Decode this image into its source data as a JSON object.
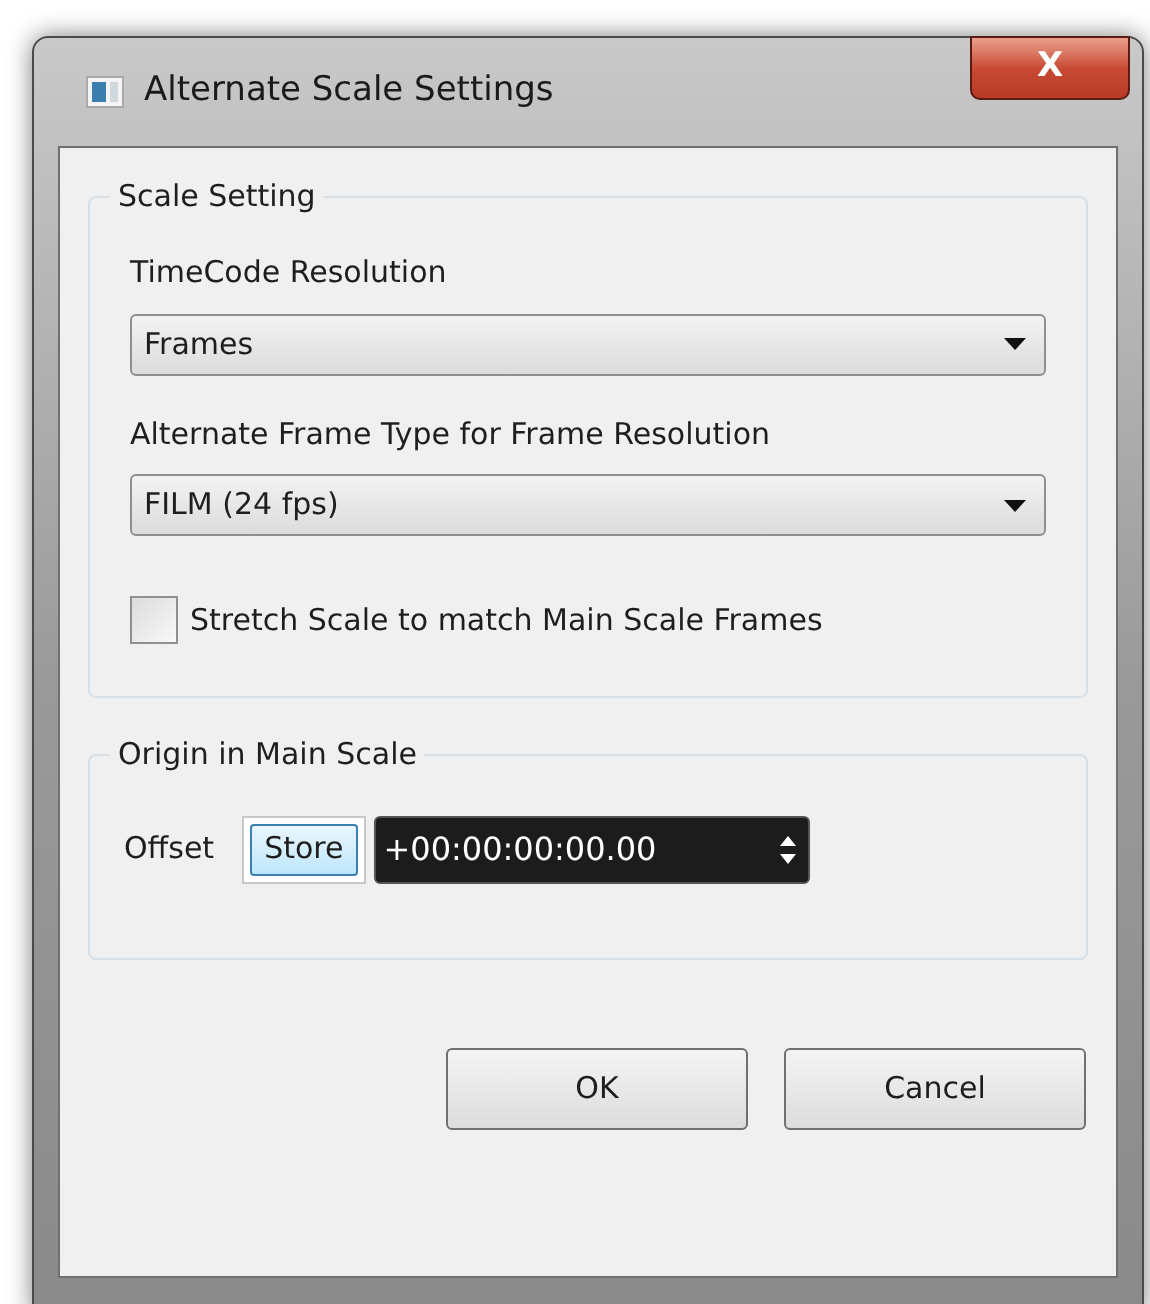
{
  "window": {
    "title": "Alternate Scale Settings",
    "close": "X"
  },
  "scale_setting": {
    "title": "Scale Setting",
    "timecode_resolution": {
      "label": "TimeCode Resolution",
      "value": "Frames"
    },
    "alternate_frame_type": {
      "label": "Alternate Frame Type for Frame Resolution",
      "value": "FILM (24 fps)"
    },
    "stretch": {
      "label": "Stretch Scale to match Main Scale Frames",
      "checked": false
    }
  },
  "origin": {
    "title": "Origin in Main Scale",
    "offset_label": "Offset",
    "store_button": "Store",
    "offset_value": "+00:00:00:00.00"
  },
  "buttons": [
    "OK",
    "Cancel"
  ]
}
